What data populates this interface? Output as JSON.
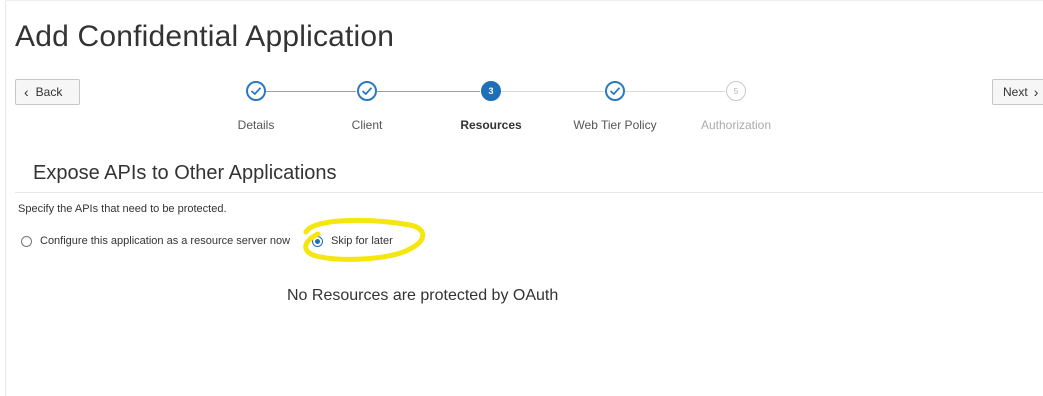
{
  "page": {
    "title": "Add Confidential Application"
  },
  "navigation": {
    "back_label": "Back",
    "next_label": "Next",
    "back_icon": "chevron-left-icon",
    "next_icon": "chevron-right-icon"
  },
  "wizard": {
    "current_step": 3,
    "steps": [
      {
        "number": "1",
        "label": "Details",
        "state": "complete"
      },
      {
        "number": "2",
        "label": "Client",
        "state": "complete"
      },
      {
        "number": "3",
        "label": "Resources",
        "state": "current"
      },
      {
        "number": "4",
        "label": "Web Tier Policy",
        "state": "complete"
      },
      {
        "number": "5",
        "label": "Authorization",
        "state": "disabled"
      }
    ]
  },
  "section": {
    "title": "Expose APIs to Other Applications",
    "instruction": "Specify the APIs that need to be protected."
  },
  "resource_options": {
    "selected": "skip",
    "configure_label": "Configure this application as a resource server now",
    "skip_label": "Skip for later"
  },
  "empty_state": {
    "message": "No Resources are protected by OAuth"
  },
  "colors": {
    "accent": "#1d6fb8",
    "highlight_marker": "#f5e60f",
    "disabled_text": "#ababab"
  }
}
